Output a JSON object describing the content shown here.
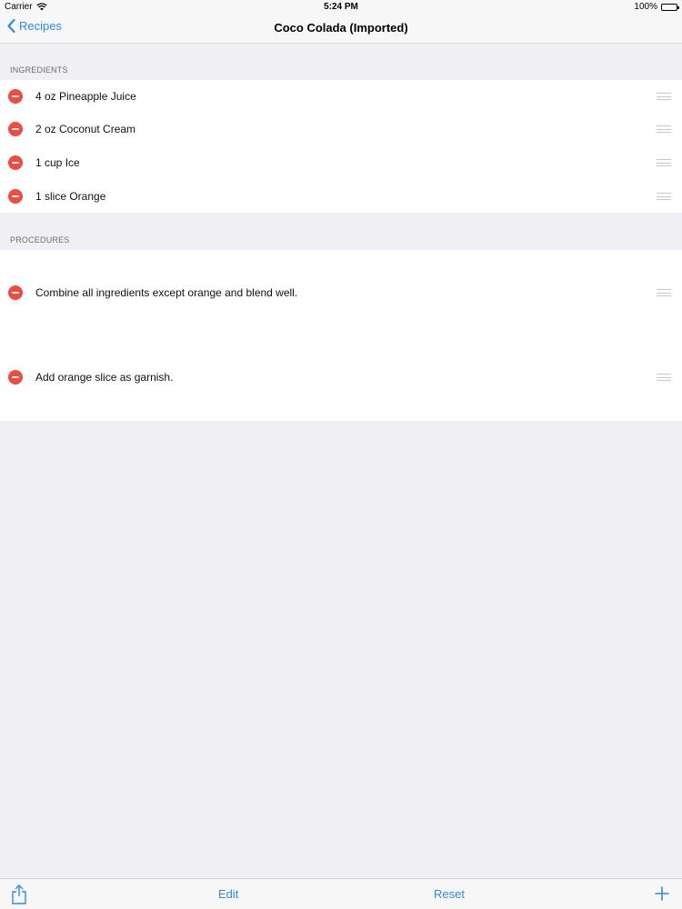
{
  "status_bar": {
    "carrier": "Carrier",
    "time": "5:24 PM",
    "battery": "100%",
    "battery_level": 1.0
  },
  "nav": {
    "back_label": "Recipes",
    "title": "Coco Colada (Imported)"
  },
  "ingredients": {
    "header": "INGREDIENTS",
    "items": [
      "4 oz Pineapple Juice",
      "2 oz Coconut Cream",
      "1 cup Ice",
      "1 slice Orange"
    ]
  },
  "procedures": {
    "header": "PROCEDURES",
    "items": [
      "Combine all ingredients except orange and blend well.",
      "Add orange slice as garnish."
    ]
  },
  "toolbar": {
    "edit_label": "Edit",
    "reset_label": "Reset"
  },
  "icons": {
    "back": "chevron-left-icon",
    "share": "share-icon",
    "add": "plus-icon",
    "delete": "minus-circle-icon",
    "reorder": "reorder-handle-icon"
  },
  "colors": {
    "accent": "#2b8be4",
    "delete_red": "#f24a3f",
    "background": "#efeff4"
  }
}
